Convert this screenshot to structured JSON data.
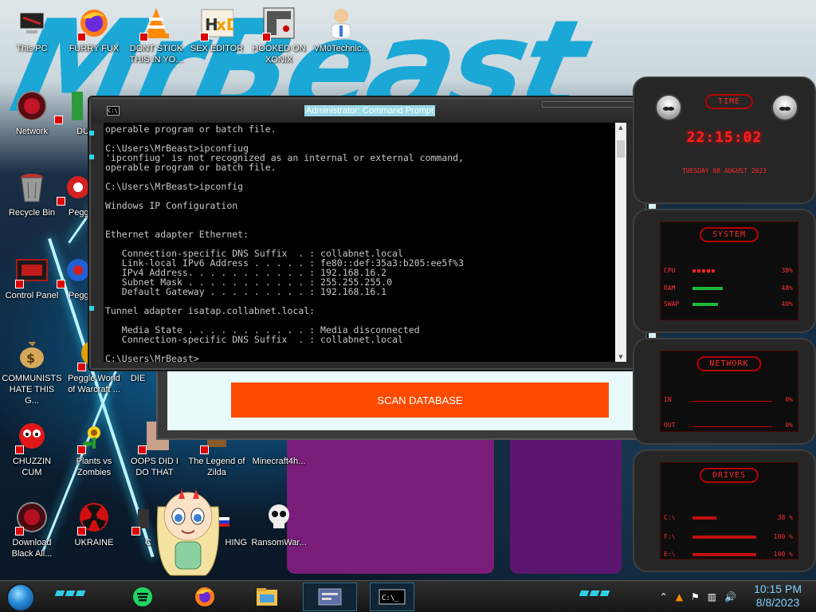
{
  "desktop": {
    "icons": [
      {
        "label": "This PC",
        "icon": "computer-icon"
      },
      {
        "label": "FURRY FUX",
        "icon": "firefox-icon"
      },
      {
        "label": "DONT STICK THIS IN YO...",
        "icon": "vlc-cone-icon"
      },
      {
        "label": "SEX EDITOR",
        "icon": "hxd-editor-icon"
      },
      {
        "label": "HOOKED ON XONIX",
        "icon": "xonix-game-icon"
      },
      {
        "label": "VM0Technic...",
        "icon": "doctor-avatar-icon"
      },
      {
        "label": "Network",
        "icon": "network-orb-icon"
      },
      {
        "label": "DU",
        "icon": "partial-icon"
      },
      {
        "label": "Recycle Bin",
        "icon": "recycle-bin-icon"
      },
      {
        "label": "Peggl",
        "icon": "peggle-icon"
      },
      {
        "label": "Control Panel",
        "icon": "control-panel-icon"
      },
      {
        "label": "Peggl",
        "icon": "peggle-icon"
      },
      {
        "label": "COMMUNISTS HATE THIS G...",
        "icon": "money-bag-icon"
      },
      {
        "label": "Peggle World of Warcraft ...",
        "icon": "peggle-icon"
      },
      {
        "label": "DIE",
        "icon": "partial-icon"
      },
      {
        "label": "CHUZZIN CUM",
        "icon": "chuzzle-icon"
      },
      {
        "label": "Plants vs Zombies",
        "icon": "plant-icon"
      },
      {
        "label": "OOPS DID I DO THAT",
        "icon": "photo-icon"
      },
      {
        "label": "The Legend of Zilda",
        "icon": "zelda-icon"
      },
      {
        "label": "Minecraft4h...",
        "icon": "minecraft-icon"
      },
      {
        "label": "Download Black Ali...",
        "icon": "alien-orb-icon"
      },
      {
        "label": "UKRAINE",
        "icon": "radiation-icon"
      },
      {
        "label": "C",
        "icon": "partial-icon"
      },
      {
        "label": "HING",
        "icon": "flag-icon"
      },
      {
        "label": "RansomWar...",
        "icon": "skull-icon"
      }
    ]
  },
  "cmd": {
    "title": "Administrator: Command Prompt",
    "lines": [
      "operable program or batch file.",
      "",
      "C:\\Users\\MrBeast>ipconfiug",
      "'ipconfiug' is not recognized as an internal or external command,",
      "operable program or batch file.",
      "",
      "C:\\Users\\MrBeast>ipconfig",
      "",
      "Windows IP Configuration",
      "",
      "",
      "Ethernet adapter Ethernet:",
      "",
      "   Connection-specific DNS Suffix  . : collabnet.local",
      "   Link-local IPv6 Address . . . . . : fe80::def:35a3:b205:ee5f%3",
      "   IPv4 Address. . . . . . . . . . . : 192.168.16.2",
      "   Subnet Mask . . . . . . . . . . . : 255.255.255.0",
      "   Default Gateway . . . . . . . . . : 192.168.16.1",
      "",
      "Tunnel adapter isatap.collabnet.local:",
      "",
      "   Media State . . . . . . . . . . . : Media disconnected",
      "   Connection-specific DNS Suffix  . : collabnet.local",
      "",
      "C:\\Users\\MrBeast>"
    ]
  },
  "app": {
    "scan_button": "SCAN DATABASE"
  },
  "gadgets": {
    "time": {
      "header": "TIME",
      "clock": "22:15:02",
      "date": "TUESDAY 08 AUGUST 2023"
    },
    "system": {
      "header": "SYSTEM",
      "rows": [
        {
          "key": "CPU",
          "value": "38%",
          "level": 0.38
        },
        {
          "key": "RAM",
          "value": "48%",
          "level": 0.48
        },
        {
          "key": "SWAP",
          "value": "40%",
          "level": 0.4
        }
      ]
    },
    "network": {
      "header": "NETWORK",
      "rows": [
        {
          "key": "IN",
          "value": "0%"
        },
        {
          "key": "OUT",
          "value": "0%"
        }
      ]
    },
    "drives": {
      "header": "DRIVES",
      "rows": [
        {
          "key": "C:\\",
          "value": "38 %",
          "level": 0.38
        },
        {
          "key": "F:\\",
          "value": "100 %",
          "level": 1.0
        },
        {
          "key": "E:\\",
          "value": "100 %",
          "level": 1.0
        }
      ]
    }
  },
  "taskbar": {
    "pinned": [
      "spotify-icon",
      "firefox-icon",
      "file-explorer-icon",
      "control-panel-window-icon",
      "cmd-icon"
    ],
    "clock_time": "10:15 PM",
    "clock_date": "8/8/2023",
    "tray": [
      "chevron-up-icon",
      "vlc-tray-icon",
      "flag-icon",
      "network-icon",
      "volume-icon"
    ]
  },
  "colors": {
    "accent_cyan": "#31d3e8",
    "gadget_red": "#ff2020",
    "scan_orange": "#ff4b00"
  }
}
